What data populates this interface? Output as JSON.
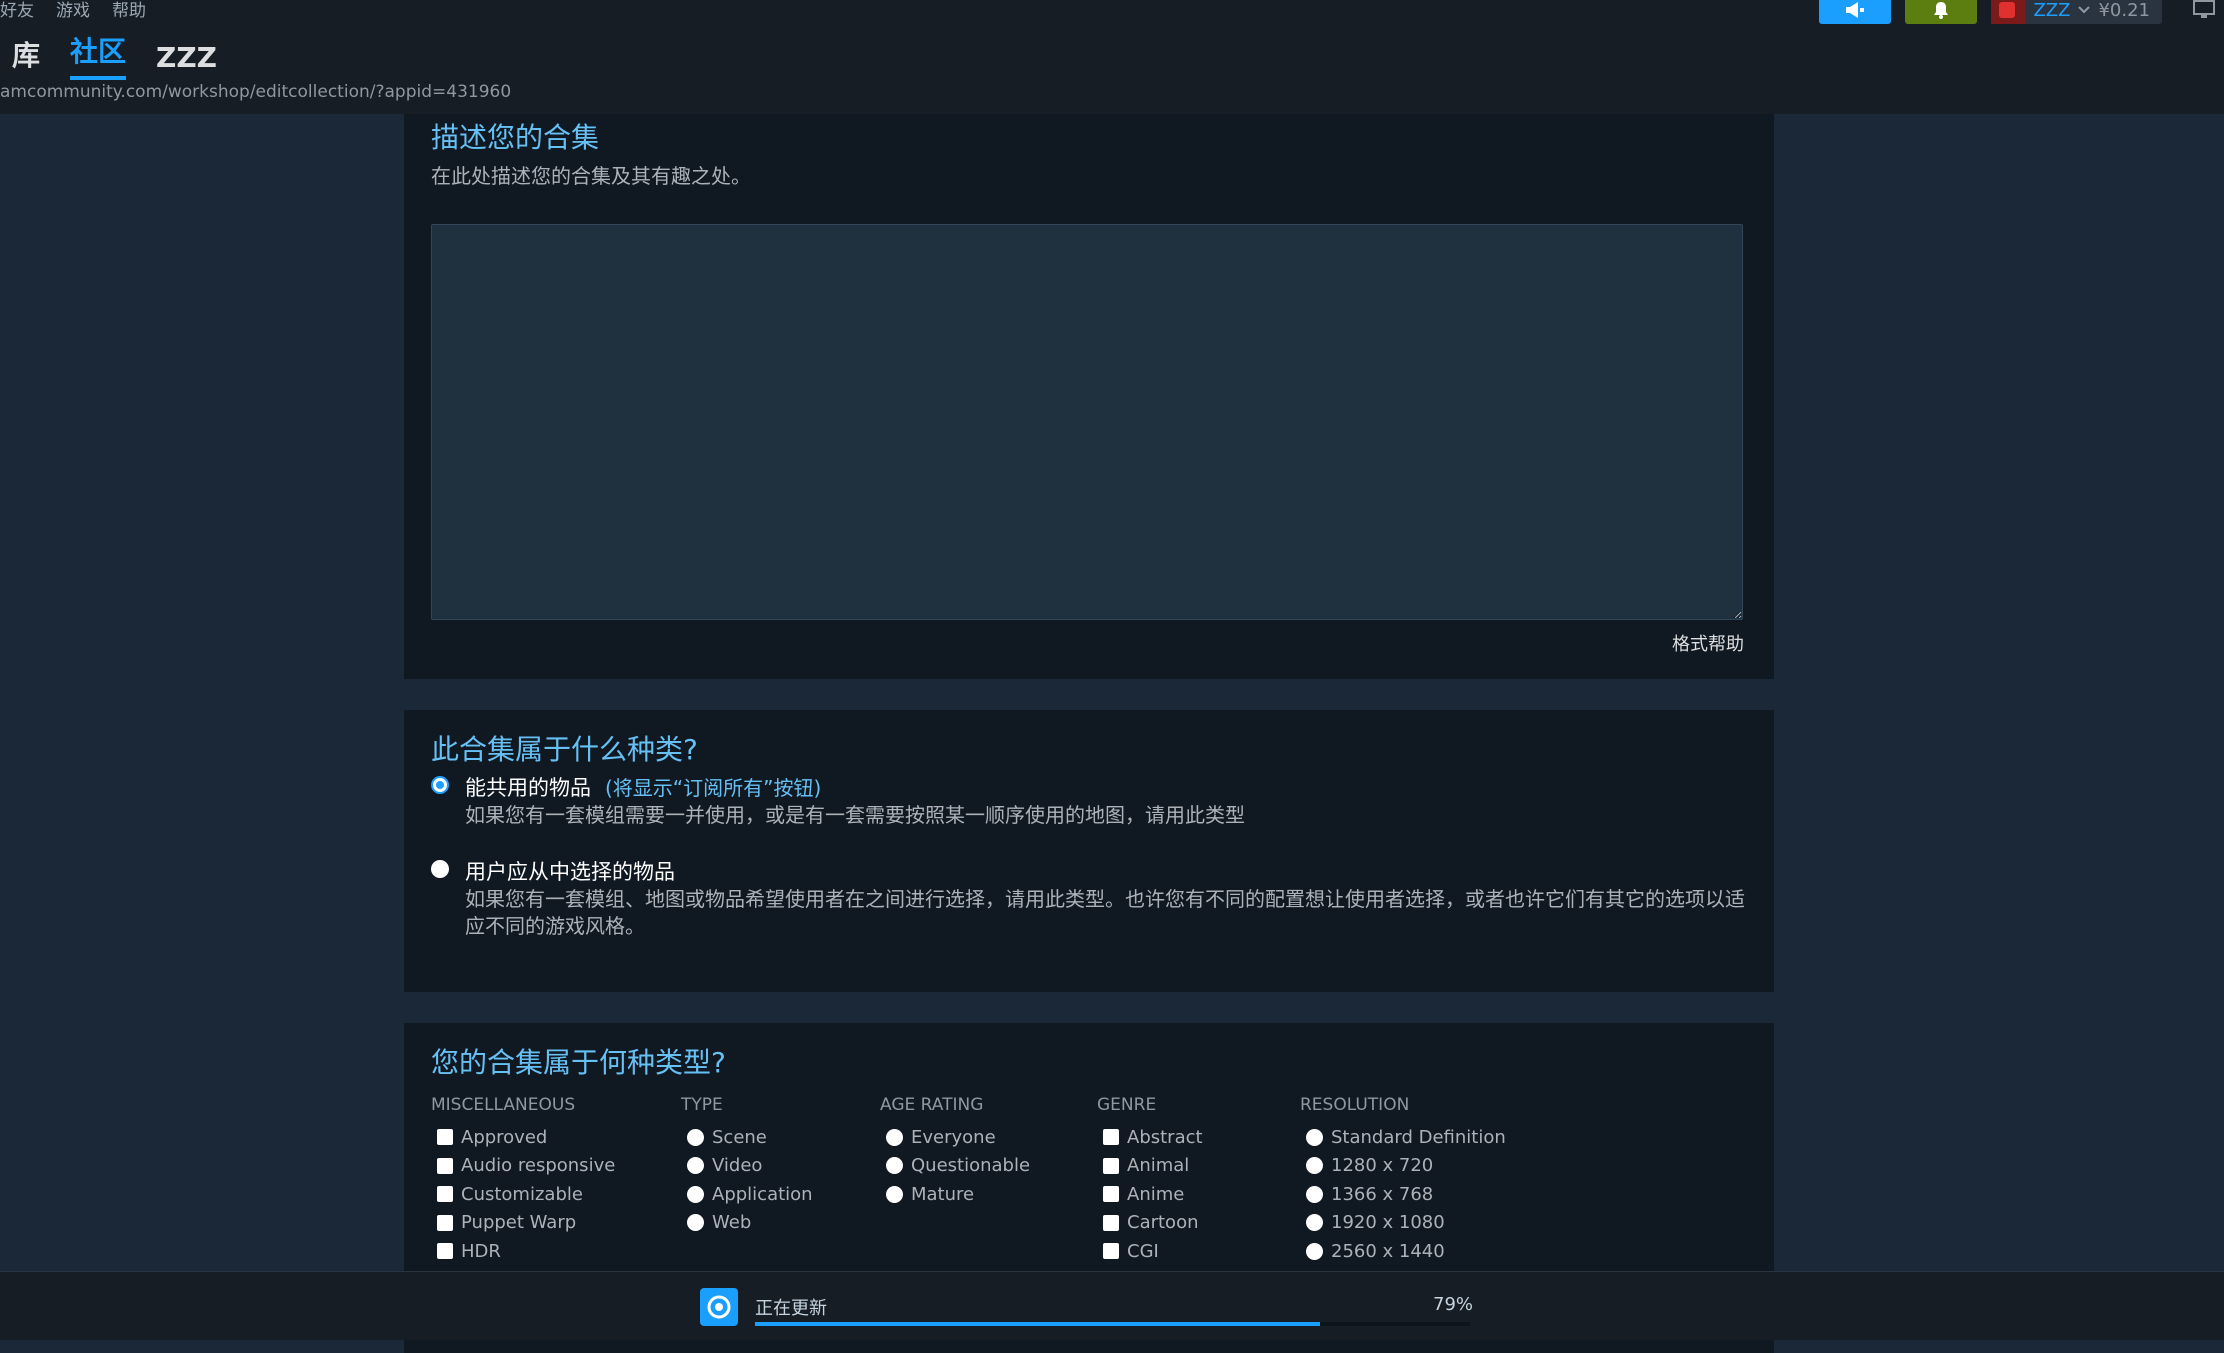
{
  "menu": [
    "好友",
    "游戏",
    "帮助"
  ],
  "nav": {
    "library": "库",
    "community": "社区",
    "user": "ZZZ"
  },
  "url": "amcommunity.com/workshop/editcollection/?appid=431960",
  "account": {
    "name": "ZZZ",
    "balance": "¥0.21"
  },
  "colors": {
    "accent": "#1a9fff",
    "bell": "#5c7e10",
    "heading": "#66c0f4"
  },
  "icons": {
    "announce": "megaphone-icon",
    "bell": "bell-icon",
    "monitor": "monitor-icon",
    "download": "steam-download-icon"
  },
  "describe": {
    "title": "描述您的合集",
    "subtitle": "在此处描述您的合集及其有趣之处。",
    "textarea_value": "",
    "format_help": "格式帮助"
  },
  "kind": {
    "title": "此合集属于什么种类?",
    "options": [
      {
        "title": "能共用的物品",
        "hint": "(将显示“订阅所有”按钮)",
        "desc": "如果您有一套模组需要一并使用，或是有一套需要按照某一顺序使用的地图，请用此类型",
        "selected": true
      },
      {
        "title": "用户应从中选择的物品",
        "hint": "",
        "desc": "如果您有一套模组、地图或物品希望使用者在之间进行选择，请用此类型。也许您有不同的配置想让使用者选择，或者也许它们有其它的选项以适应不同的游戏风格。",
        "selected": false
      }
    ]
  },
  "types": {
    "title": "您的合集属于何种类型?",
    "columns": [
      {
        "title": "MISCELLANEOUS",
        "input": "checkbox",
        "items": [
          "Approved",
          "Audio responsive",
          "Customizable",
          "Puppet Warp",
          "HDR"
        ]
      },
      {
        "title": "TYPE",
        "input": "radio",
        "items": [
          "Scene",
          "Video",
          "Application",
          "Web"
        ]
      },
      {
        "title": "AGE RATING",
        "input": "radio",
        "items": [
          "Everyone",
          "Questionable",
          "Mature"
        ]
      },
      {
        "title": "GENRE",
        "input": "checkbox",
        "items": [
          "Abstract",
          "Animal",
          "Anime",
          "Cartoon",
          "CGI"
        ]
      },
      {
        "title": "RESOLUTION",
        "input": "radio",
        "items": [
          "Standard Definition",
          "1280 x 720",
          "1366 x 768",
          "1920 x 1080",
          "2560 x 1440"
        ]
      }
    ]
  },
  "download": {
    "status": "正在更新",
    "percent_label": "79%",
    "progress": 0.79
  }
}
